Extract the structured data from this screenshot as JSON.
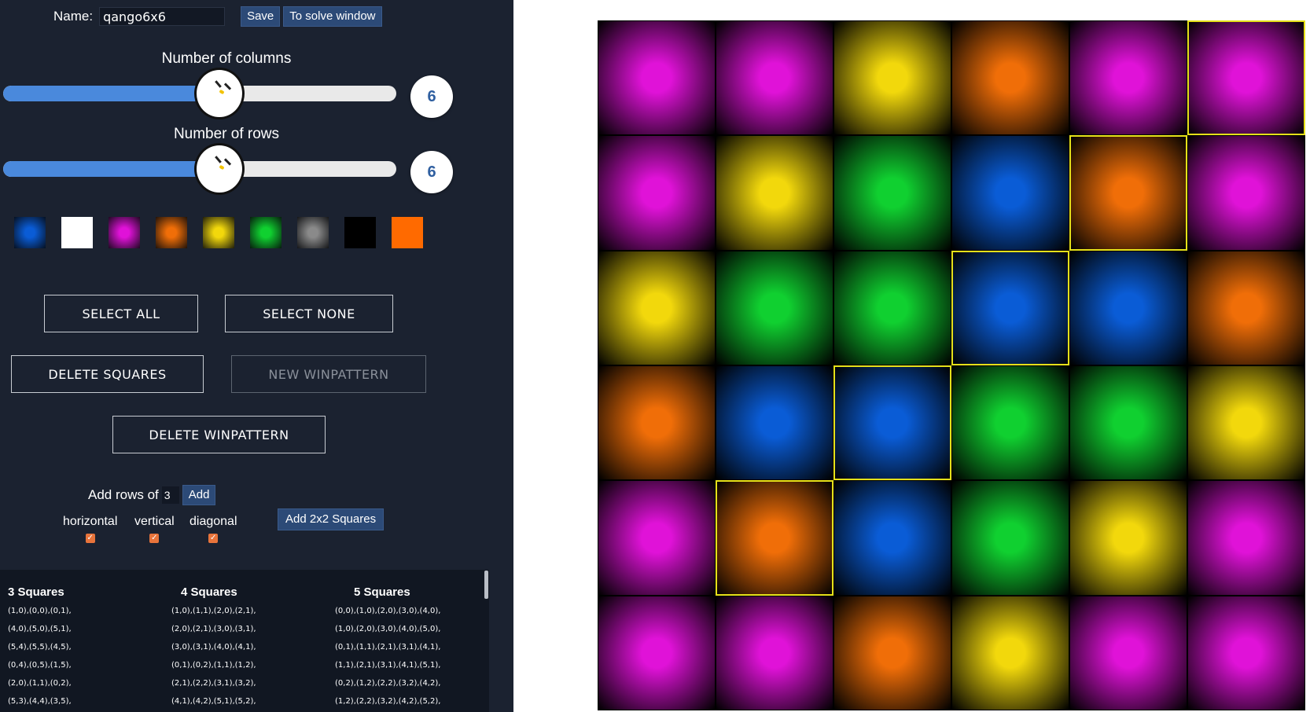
{
  "editor": {
    "name_label": "Name:",
    "name_value": "qango6x6",
    "save_label": "Save",
    "solve_label": "To solve window"
  },
  "columns_slider": {
    "title": "Number of columns",
    "value": "6",
    "fraction": 0.5
  },
  "rows_slider": {
    "title": "Number of rows",
    "value": "6",
    "fraction": 0.5
  },
  "colors": {
    "blue": "#0a5cd6",
    "white": "#ffffff",
    "magenta": "#e012d8",
    "orange": "#f06e08",
    "yellow": "#f2d80c",
    "green": "#10d030",
    "gray": "#8a8a8a",
    "black": "#000000",
    "solid_orange": "#ff6a00",
    "highlight": "#e5e019"
  },
  "palette": [
    "blue",
    "white",
    "magenta",
    "orange",
    "yellow",
    "green",
    "gray",
    "black",
    "solid_orange"
  ],
  "buttons": {
    "select_all": "SELECT ALL",
    "select_none": "SELECT NONE",
    "delete_squares": "DELETE SQUARES",
    "new_winpattern": "NEW WINPATTERN",
    "delete_winpattern": "DELETE WINPATTERN"
  },
  "add_rows": {
    "label": "Add rows of",
    "value": "3",
    "add_label": "Add",
    "horizontal": "horizontal",
    "vertical": "vertical",
    "diagonal": "diagonal",
    "add_2x2": "Add 2x2 Squares"
  },
  "lists": [
    {
      "title": "3 Squares",
      "items": [
        "(1,0),(0,0),(0,1),",
        "(4,0),(5,0),(5,1),",
        "(5,4),(5,5),(4,5),",
        "(0,4),(0,5),(1,5),",
        "(2,0),(1,1),(0,2),",
        "(5,3),(4,4),(3,5),"
      ]
    },
    {
      "title": "4 Squares",
      "items": [
        "(1,0),(1,1),(2,0),(2,1),",
        "(2,0),(2,1),(3,0),(3,1),",
        "(3,0),(3,1),(4,0),(4,1),",
        "(0,1),(0,2),(1,1),(1,2),",
        "(2,1),(2,2),(3,1),(3,2),",
        "(4,1),(4,2),(5,1),(5,2),"
      ]
    },
    {
      "title": "5 Squares",
      "items": [
        "(0,0),(1,0),(2,0),(3,0),(4,0),",
        "(1,0),(2,0),(3,0),(4,0),(5,0),",
        "(0,1),(1,1),(2,1),(3,1),(4,1),",
        "(1,1),(2,1),(3,1),(4,1),(5,1),",
        "(0,2),(1,2),(2,2),(3,2),(4,2),",
        "(1,2),(2,2),(3,2),(4,2),(5,2),"
      ]
    }
  ],
  "board": {
    "cells": [
      [
        "magenta",
        "magenta",
        "yellow",
        "orange",
        "magenta",
        "magenta"
      ],
      [
        "magenta",
        "yellow",
        "green",
        "blue",
        "orange",
        "magenta"
      ],
      [
        "yellow",
        "green",
        "green",
        "blue",
        "blue",
        "orange"
      ],
      [
        "orange",
        "blue",
        "blue",
        "green",
        "green",
        "yellow"
      ],
      [
        "magenta",
        "orange",
        "blue",
        "green",
        "yellow",
        "magenta"
      ],
      [
        "magenta",
        "magenta",
        "orange",
        "yellow",
        "magenta",
        "magenta"
      ]
    ],
    "selected": [
      [
        5,
        0
      ],
      [
        4,
        1
      ],
      [
        3,
        2
      ],
      [
        2,
        3
      ],
      [
        1,
        4
      ]
    ]
  }
}
